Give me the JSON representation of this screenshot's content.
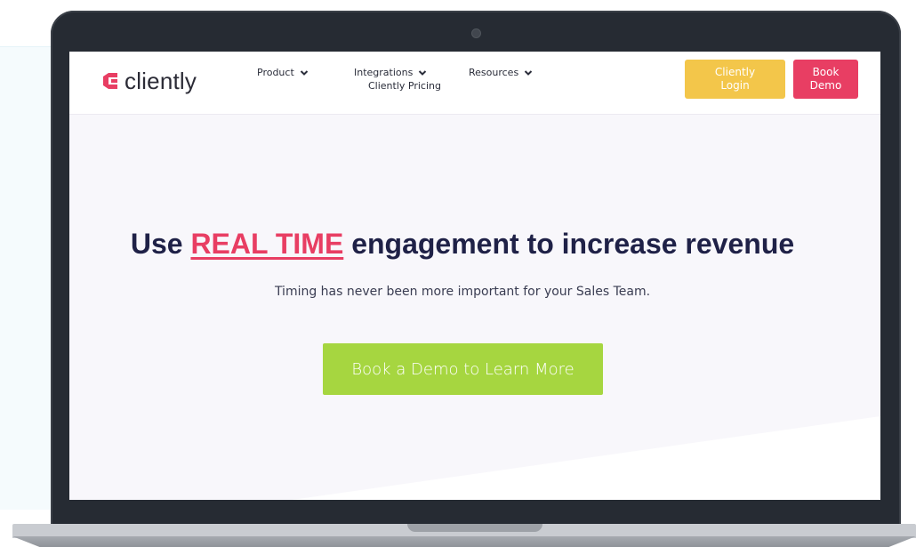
{
  "brand": {
    "name": "cliently"
  },
  "nav": {
    "items": [
      {
        "label": "Product"
      },
      {
        "label": "Integrations"
      },
      {
        "label": "Resources"
      }
    ],
    "sub_item": "Cliently Pricing",
    "login_label": "Cliently Login",
    "book_label": "Book Demo"
  },
  "hero": {
    "title_before": "Use ",
    "title_highlight": "REAL TIME",
    "title_after": " engagement to increase revenue",
    "subtitle": "Timing has never been more important for your Sales Team.",
    "cta_label": "Book a Demo to Learn More"
  },
  "colors": {
    "accent_pink": "#e83e63",
    "accent_yellow": "#f3c64a",
    "accent_green": "#a6d640",
    "heading_navy": "#1f2147"
  },
  "icons": {
    "logo": "cliently-logo-icon",
    "dropdown": "chevron-down-icon",
    "camera": "camera-icon"
  }
}
